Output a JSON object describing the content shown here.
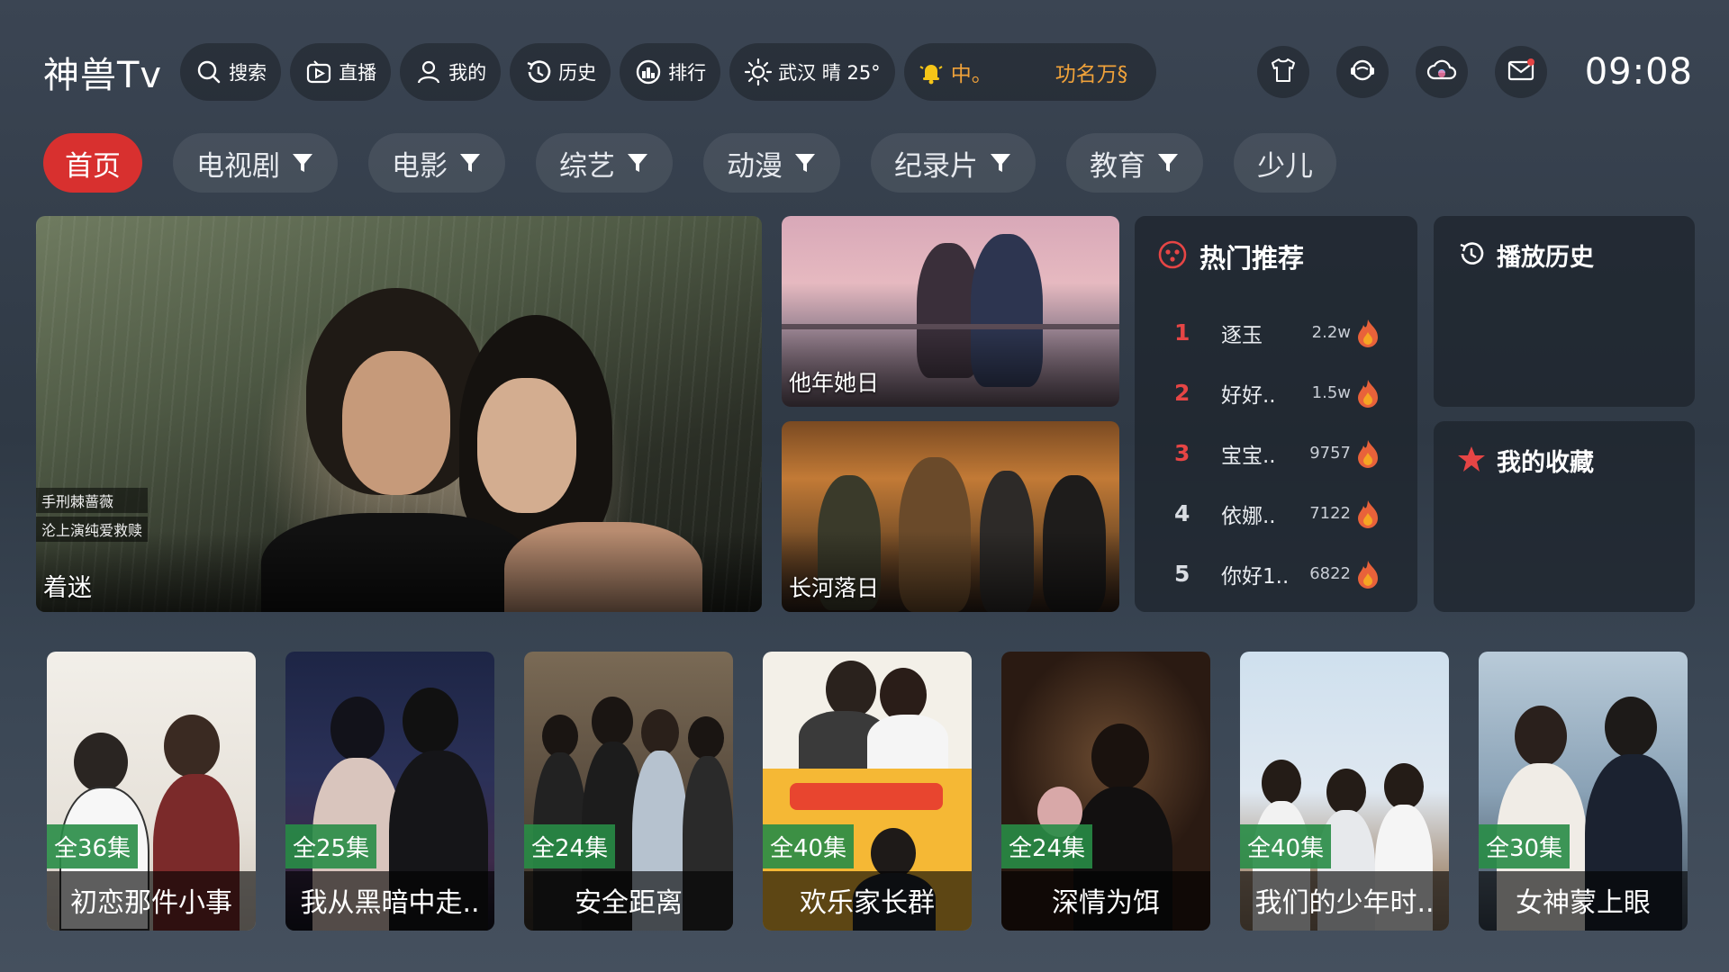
{
  "app": {
    "logo": "神兽Tv"
  },
  "topbar": {
    "buttons": [
      {
        "label": "搜索",
        "icon": "search-icon"
      },
      {
        "label": "直播",
        "icon": "live-tv-icon"
      },
      {
        "label": "我的",
        "icon": "user-icon"
      },
      {
        "label": "历史",
        "icon": "history-icon"
      },
      {
        "label": "排行",
        "icon": "ranking-icon"
      }
    ],
    "weather": {
      "label": "武汉 晴 25°",
      "icon": "sun-icon"
    },
    "notice": {
      "text_1": "中。",
      "text_2": "功名万§",
      "icon": "bell-icon"
    },
    "right_icons": [
      "shirt-icon",
      "support-icon",
      "cloud-icon",
      "mail-icon"
    ],
    "clock": "09:08"
  },
  "nav": {
    "tabs": [
      {
        "label": "首页",
        "filter": false,
        "active": true
      },
      {
        "label": "电视剧",
        "filter": true
      },
      {
        "label": "电影",
        "filter": true
      },
      {
        "label": "综艺",
        "filter": true
      },
      {
        "label": "动漫",
        "filter": true
      },
      {
        "label": "纪录片",
        "filter": true
      },
      {
        "label": "教育",
        "filter": true
      },
      {
        "label": "少儿",
        "filter": false
      }
    ]
  },
  "feature": {
    "title": "着迷",
    "tags": [
      "手刑棘蔷薇",
      "沦上演纯爱救赎"
    ]
  },
  "small_cards": [
    {
      "title": "他年她日"
    },
    {
      "title": "长河落日"
    }
  ],
  "hot": {
    "title": "热门推荐",
    "items": [
      {
        "rank": "1",
        "name": "逐玉",
        "count": "2.2w"
      },
      {
        "rank": "2",
        "name": "好好..",
        "count": "1.5w"
      },
      {
        "rank": "3",
        "name": "宝宝..",
        "count": "9757"
      },
      {
        "rank": "4",
        "name": "依娜..",
        "count": "7122"
      },
      {
        "rank": "5",
        "name": "你好1..",
        "count": "6822"
      }
    ]
  },
  "history": {
    "title": "播放历史"
  },
  "favorites": {
    "title": "我的收藏"
  },
  "posters": [
    {
      "badge": "全36集",
      "title": "初恋那件小事"
    },
    {
      "badge": "全25集",
      "title": "我从黑暗中走.."
    },
    {
      "badge": "全24集",
      "title": "安全距离"
    },
    {
      "badge": "全40集",
      "title": "欢乐家长群"
    },
    {
      "badge": "全24集",
      "title": "深情为饵"
    },
    {
      "badge": "全40集",
      "title": "我们的少年时.."
    },
    {
      "badge": "全30集",
      "title": "女神蒙上眼"
    }
  ],
  "colors": {
    "accent": "#d8302f",
    "hot_rank": "#e64545",
    "badge": "#288c46",
    "notice": "#f0a23a"
  }
}
